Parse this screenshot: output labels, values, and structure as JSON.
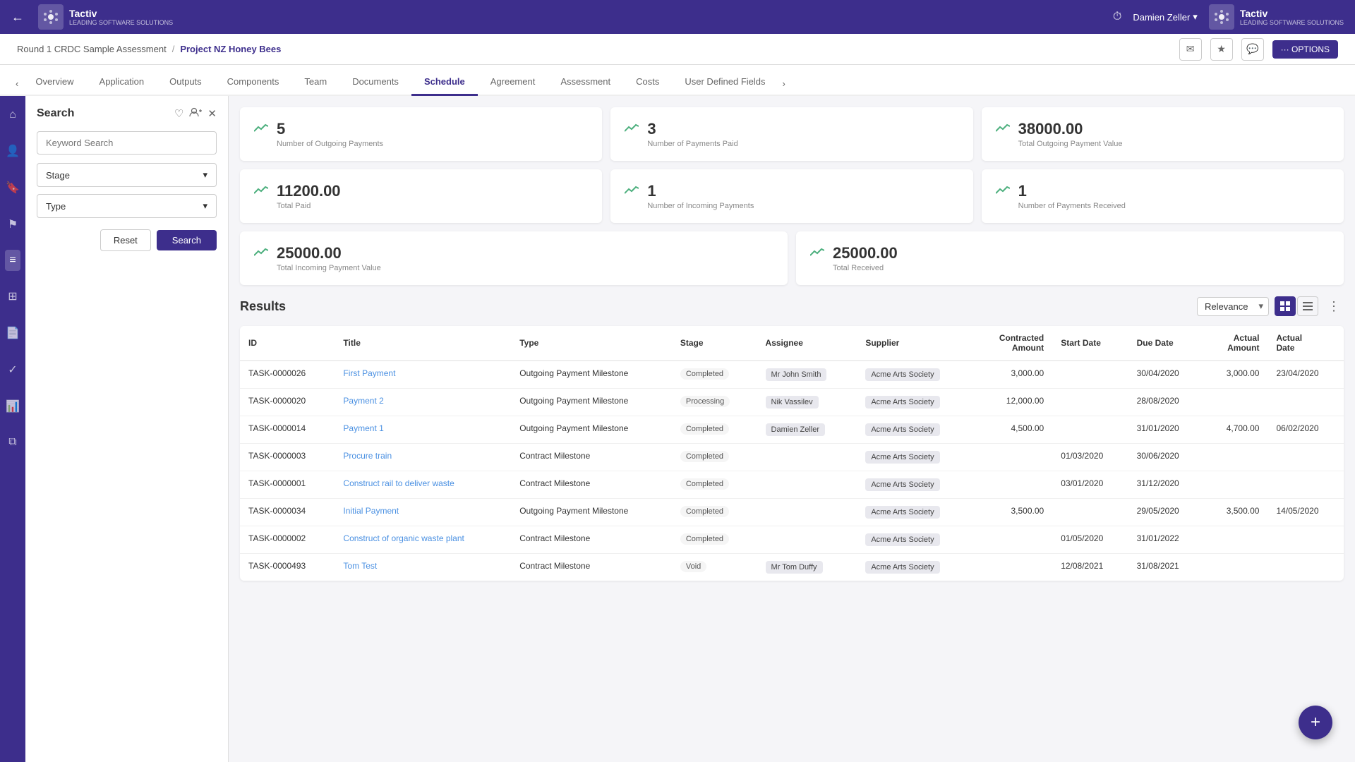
{
  "topNav": {
    "backArrow": "←",
    "logoIcon": "⬡",
    "logoText": "Tactiv",
    "logoSubText": "LEADING\nSOFTWARE\nSOLUTIONS",
    "historyIcon": "🕐",
    "userName": "Damien Zeller",
    "userDropArrow": "▾",
    "rightLogoText": "Tactiv"
  },
  "breadcrumb": {
    "parent": "Round 1 CRDC Sample Assessment",
    "separator": "/",
    "current": "Project NZ Honey Bees",
    "mailIcon": "✉",
    "starIcon": "★",
    "chatIcon": "💬",
    "optionsLabel": "··· OPTIONS"
  },
  "tabs": [
    {
      "label": "Overview",
      "active": false
    },
    {
      "label": "Application",
      "active": false
    },
    {
      "label": "Outputs",
      "active": false
    },
    {
      "label": "Components",
      "active": false
    },
    {
      "label": "Team",
      "active": false
    },
    {
      "label": "Documents",
      "active": false
    },
    {
      "label": "Schedule",
      "active": true
    },
    {
      "label": "Agreement",
      "active": false
    },
    {
      "label": "Assessment",
      "active": false
    },
    {
      "label": "Costs",
      "active": false
    },
    {
      "label": "User Defined Fields",
      "active": false
    }
  ],
  "sidebar": {
    "icons": [
      {
        "name": "home",
        "symbol": "⌂",
        "active": false
      },
      {
        "name": "user",
        "symbol": "👤",
        "active": false
      },
      {
        "name": "bookmark",
        "symbol": "🔖",
        "active": false
      },
      {
        "name": "flag",
        "symbol": "⚑",
        "active": false
      },
      {
        "name": "list",
        "symbol": "≡",
        "active": true
      },
      {
        "name": "grid",
        "symbol": "⊞",
        "active": false
      },
      {
        "name": "document",
        "symbol": "📄",
        "active": false
      },
      {
        "name": "check",
        "symbol": "✓",
        "active": false
      },
      {
        "name": "chart",
        "symbol": "📊",
        "active": false
      },
      {
        "name": "copy",
        "symbol": "⧉",
        "active": false
      }
    ]
  },
  "searchPanel": {
    "title": "Search",
    "heartIcon": "♡",
    "addPersonIcon": "👥",
    "closeIcon": "✕",
    "keywordPlaceholder": "Keyword Search",
    "stageLabel": "Stage",
    "typeLabel": "Type",
    "resetLabel": "Reset",
    "searchLabel": "Search"
  },
  "stats": {
    "row1": [
      {
        "value": "5",
        "label": "Number of Outgoing Payments"
      },
      {
        "value": "3",
        "label": "Number of Payments Paid"
      },
      {
        "value": "38000.00",
        "label": "Total Outgoing Payment Value"
      }
    ],
    "row2": [
      {
        "value": "11200.00",
        "label": "Total Paid"
      },
      {
        "value": "1",
        "label": "Number of Incoming Payments"
      },
      {
        "value": "1",
        "label": "Number of Payments Received"
      }
    ],
    "row3": [
      {
        "value": "25000.00",
        "label": "Total Incoming Payment Value"
      },
      {
        "value": "25000.00",
        "label": "Total Received"
      }
    ]
  },
  "results": {
    "title": "Results",
    "sortLabel": "Relevance",
    "viewGridActive": true,
    "moreIcon": "⋮",
    "columns": [
      "ID",
      "Title",
      "Type",
      "Stage",
      "Assignee",
      "Supplier",
      "Contracted Amount",
      "Start Date",
      "Due Date",
      "Actual Amount",
      "Actual Date"
    ],
    "rows": [
      {
        "id": "TASK-0000026",
        "title": "First Payment",
        "type": "Outgoing Payment Milestone",
        "stage": "Completed",
        "assignee": "Mr John Smith",
        "supplier": "Acme Arts Society",
        "contractedAmount": "3,000.00",
        "startDate": "",
        "dueDate": "30/04/2020",
        "actualAmount": "3,000.00",
        "actualDate": "23/04/2020"
      },
      {
        "id": "TASK-0000020",
        "title": "Payment 2",
        "type": "Outgoing Payment Milestone",
        "stage": "Processing",
        "assignee": "Nik Vassilev",
        "supplier": "Acme Arts Society",
        "contractedAmount": "12,000.00",
        "startDate": "",
        "dueDate": "28/08/2020",
        "actualAmount": "",
        "actualDate": ""
      },
      {
        "id": "TASK-0000014",
        "title": "Payment 1",
        "type": "Outgoing Payment Milestone",
        "stage": "Completed",
        "assignee": "Damien Zeller",
        "supplier": "Acme Arts Society",
        "contractedAmount": "4,500.00",
        "startDate": "",
        "dueDate": "31/01/2020",
        "actualAmount": "4,700.00",
        "actualDate": "06/02/2020"
      },
      {
        "id": "TASK-0000003",
        "title": "Procure train",
        "type": "Contract Milestone",
        "stage": "Completed",
        "assignee": "",
        "supplier": "Acme Arts Society",
        "contractedAmount": "",
        "startDate": "01/03/2020",
        "dueDate": "30/06/2020",
        "actualAmount": "",
        "actualDate": ""
      },
      {
        "id": "TASK-0000001",
        "title": "Construct rail to deliver waste",
        "type": "Contract Milestone",
        "stage": "Completed",
        "assignee": "",
        "supplier": "Acme Arts Society",
        "contractedAmount": "",
        "startDate": "03/01/2020",
        "dueDate": "31/12/2020",
        "actualAmount": "",
        "actualDate": ""
      },
      {
        "id": "TASK-0000034",
        "title": "Initial Payment",
        "type": "Outgoing Payment Milestone",
        "stage": "Completed",
        "assignee": "",
        "supplier": "Acme Arts Society",
        "contractedAmount": "3,500.00",
        "startDate": "",
        "dueDate": "29/05/2020",
        "actualAmount": "3,500.00",
        "actualDate": "14/05/2020"
      },
      {
        "id": "TASK-0000002",
        "title": "Construct of organic waste plant",
        "type": "Contract Milestone",
        "stage": "Completed",
        "assignee": "",
        "supplier": "Acme Arts Society",
        "contractedAmount": "",
        "startDate": "01/05/2020",
        "dueDate": "31/01/2022",
        "actualAmount": "",
        "actualDate": ""
      },
      {
        "id": "TASK-0000493",
        "title": "Tom Test",
        "type": "Contract Milestone",
        "stage": "Void",
        "assignee": "Mr Tom Duffy",
        "supplier": "Acme Arts Society",
        "contractedAmount": "",
        "startDate": "12/08/2021",
        "dueDate": "31/08/2021",
        "actualAmount": "",
        "actualDate": ""
      }
    ]
  },
  "fab": {
    "label": "+"
  }
}
